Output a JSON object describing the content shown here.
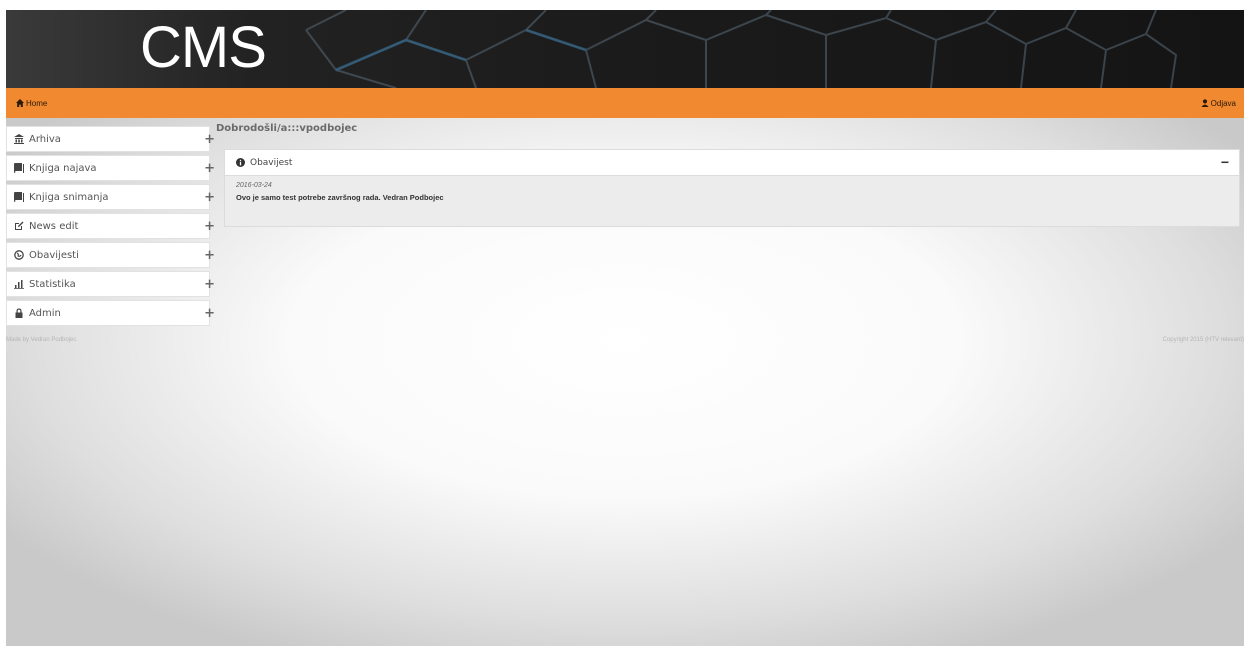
{
  "header": {
    "logo": "CMS"
  },
  "navbar": {
    "home_label": "Home",
    "logout_label": "Odjava"
  },
  "sidebar": {
    "items": [
      {
        "label": "Arhiva",
        "icon": "archive-icon"
      },
      {
        "label": "Knjiga najava",
        "icon": "book-icon"
      },
      {
        "label": "Knjiga snimanja",
        "icon": "book-icon"
      },
      {
        "label": "News edit",
        "icon": "edit-icon"
      },
      {
        "label": "Obavijesti",
        "icon": "globe-icon"
      },
      {
        "label": "Statistika",
        "icon": "stats-icon"
      },
      {
        "label": "Admin",
        "icon": "lock-icon"
      }
    ],
    "expand_symbol": "+"
  },
  "main": {
    "welcome": "Dobrodošli/a:::vpodbojec",
    "panel": {
      "title": "Obavijest",
      "collapse_symbol": "−",
      "date": "2016-03-24",
      "message": "Ovo je samo test potrebe završnog rada. Vedran Podbojec"
    }
  },
  "footer": {
    "left": "Made by Vedran Podbojec",
    "right": "Copyright 2015 (HTV relevant)"
  },
  "colors": {
    "accent": "#f0892f",
    "banner": "#1b1b1b"
  }
}
